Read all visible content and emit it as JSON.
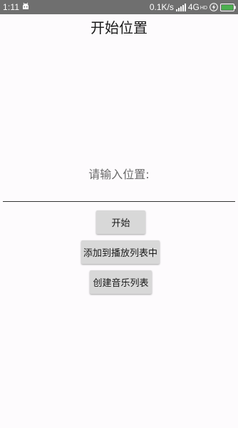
{
  "status_bar": {
    "time": "1:11",
    "net_speed": "0.1K/s",
    "network": "4G",
    "network_sub": "HD",
    "android_icon": "android-icon",
    "signal_icon": "signal-icon",
    "charging_icon": "charging-icon",
    "battery_icon": "battery-icon",
    "battery_color": "#4caf50"
  },
  "page": {
    "title": "开始位置",
    "prompt": "请输入位置:",
    "input_value": "",
    "input_placeholder": ""
  },
  "buttons": {
    "start": "开始",
    "add_to_playlist": "添加到播放列表中",
    "create_music_list": "创建音乐列表"
  }
}
